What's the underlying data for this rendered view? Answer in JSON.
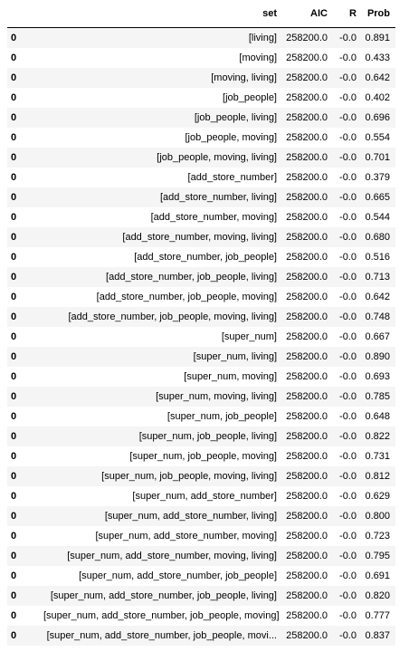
{
  "table": {
    "headers": [
      "",
      "set",
      "AIC",
      "R",
      "Prob"
    ],
    "rows": [
      [
        "0",
        "[living]",
        "258200.0",
        "-0.0",
        "0.891"
      ],
      [
        "0",
        "[moving]",
        "258200.0",
        "-0.0",
        "0.433"
      ],
      [
        "0",
        "[moving, living]",
        "258200.0",
        "-0.0",
        "0.642"
      ],
      [
        "0",
        "[job_people]",
        "258200.0",
        "-0.0",
        "0.402"
      ],
      [
        "0",
        "[job_people, living]",
        "258200.0",
        "-0.0",
        "0.696"
      ],
      [
        "0",
        "[job_people, moving]",
        "258200.0",
        "-0.0",
        "0.554"
      ],
      [
        "0",
        "[job_people, moving, living]",
        "258200.0",
        "-0.0",
        "0.701"
      ],
      [
        "0",
        "[add_store_number]",
        "258200.0",
        "-0.0",
        "0.379"
      ],
      [
        "0",
        "[add_store_number, living]",
        "258200.0",
        "-0.0",
        "0.665"
      ],
      [
        "0",
        "[add_store_number, moving]",
        "258200.0",
        "-0.0",
        "0.544"
      ],
      [
        "0",
        "[add_store_number, moving, living]",
        "258200.0",
        "-0.0",
        "0.680"
      ],
      [
        "0",
        "[add_store_number, job_people]",
        "258200.0",
        "-0.0",
        "0.516"
      ],
      [
        "0",
        "[add_store_number, job_people, living]",
        "258200.0",
        "-0.0",
        "0.713"
      ],
      [
        "0",
        "[add_store_number, job_people, moving]",
        "258200.0",
        "-0.0",
        "0.642"
      ],
      [
        "0",
        "[add_store_number, job_people, moving, living]",
        "258200.0",
        "-0.0",
        "0.748"
      ],
      [
        "0",
        "[super_num]",
        "258200.0",
        "-0.0",
        "0.667"
      ],
      [
        "0",
        "[super_num, living]",
        "258200.0",
        "-0.0",
        "0.890"
      ],
      [
        "0",
        "[super_num, moving]",
        "258200.0",
        "-0.0",
        "0.693"
      ],
      [
        "0",
        "[super_num, moving, living]",
        "258200.0",
        "-0.0",
        "0.785"
      ],
      [
        "0",
        "[super_num, job_people]",
        "258200.0",
        "-0.0",
        "0.648"
      ],
      [
        "0",
        "[super_num, job_people, living]",
        "258200.0",
        "-0.0",
        "0.822"
      ],
      [
        "0",
        "[super_num, job_people, moving]",
        "258200.0",
        "-0.0",
        "0.731"
      ],
      [
        "0",
        "[super_num, job_people, moving, living]",
        "258200.0",
        "-0.0",
        "0.812"
      ],
      [
        "0",
        "[super_num, add_store_number]",
        "258200.0",
        "-0.0",
        "0.629"
      ],
      [
        "0",
        "[super_num, add_store_number, living]",
        "258200.0",
        "-0.0",
        "0.800"
      ],
      [
        "0",
        "[super_num, add_store_number, moving]",
        "258200.0",
        "-0.0",
        "0.723"
      ],
      [
        "0",
        "[super_num, add_store_number, moving, living]",
        "258200.0",
        "-0.0",
        "0.795"
      ],
      [
        "0",
        "[super_num, add_store_number, job_people]",
        "258200.0",
        "-0.0",
        "0.691"
      ],
      [
        "0",
        "[super_num, add_store_number, job_people, living]",
        "258200.0",
        "-0.0",
        "0.820"
      ],
      [
        "0",
        "[super_num, add_store_number, job_people, moving]",
        "258200.0",
        "-0.0",
        "0.777"
      ],
      [
        "0",
        "[super_num, add_store_number, job_people, movi...",
        "258200.0",
        "-0.0",
        "0.837"
      ]
    ]
  },
  "colors": {
    "odd_row": "#f5f5f5",
    "even_row": "#ffffff",
    "text": "#000000"
  }
}
